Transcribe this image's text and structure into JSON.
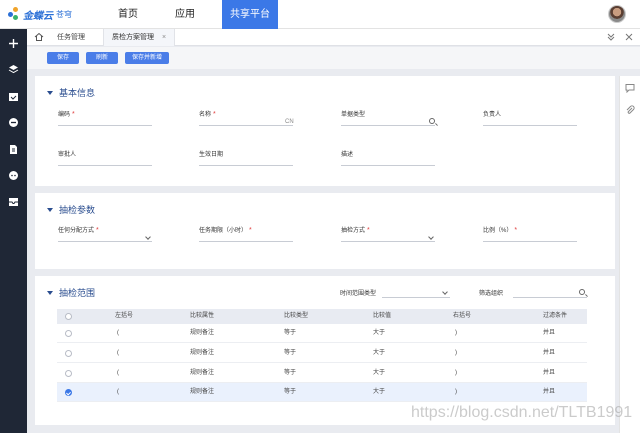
{
  "brand": {
    "name": "金蝶云",
    "sub": "苍穹",
    "colors": [
      "#2a6fd6",
      "#f0a42a",
      "#38b36b"
    ]
  },
  "top_nav": [
    {
      "label": "首页",
      "active": false
    },
    {
      "label": "应用",
      "active": false
    },
    {
      "label": "共享平台",
      "active": true
    }
  ],
  "sidebar_icons": [
    "plus-icon",
    "layers-icon",
    "calendar-check-icon",
    "minus-circle-icon",
    "document-icon",
    "chat-icon",
    "inbox-icon"
  ],
  "tabs": [
    {
      "label": "任务管理",
      "active": false,
      "closable": false
    },
    {
      "label": "质检方案管理",
      "active": true,
      "closable": true,
      "close_glyph": "×"
    }
  ],
  "toolbar": {
    "save": "保存",
    "refresh": "刷新",
    "save_new": "保存并新增"
  },
  "basic_info": {
    "title": "基本信息",
    "fields": {
      "code": {
        "label": "编码",
        "required": true
      },
      "name": {
        "label": "名称",
        "required": true,
        "suffix": "CN"
      },
      "bill_type": {
        "label": "单据类型",
        "required": false
      },
      "owner": {
        "label": "负责人",
        "required": false
      },
      "approver": {
        "label": "审批人",
        "required": false
      },
      "effective_date": {
        "label": "生效日期",
        "required": false
      },
      "description": {
        "label": "描述",
        "required": false
      }
    }
  },
  "sampling_params": {
    "title": "抽检参数",
    "fields": {
      "assign_method": {
        "label": "任何分配方式",
        "required": true
      },
      "task_deadline": {
        "label": "任务期限（小时）",
        "required": true
      },
      "sampling_method": {
        "label": "抽检方式",
        "required": true
      },
      "ratio": {
        "label": "比例（%）",
        "required": true
      }
    }
  },
  "sampling_scope": {
    "title": "抽检范围",
    "time_range_label": "时间范围类型",
    "filter_org_label": "筛选组织",
    "columns": [
      "左括号",
      "比较属性",
      "比较类型",
      "比较值",
      "右括号",
      "过滤条件"
    ],
    "rows": [
      {
        "selected": false,
        "cells": [
          "(",
          "规则备注",
          "等于",
          "大于",
          ")",
          "并且"
        ]
      },
      {
        "selected": false,
        "cells": [
          "(",
          "规则备注",
          "等于",
          "大于",
          ")",
          "并且"
        ]
      },
      {
        "selected": false,
        "cells": [
          "(",
          "规则备注",
          "等于",
          "大于",
          ")",
          "并且"
        ]
      },
      {
        "selected": true,
        "cells": [
          "(",
          "规则备注",
          "等于",
          "大于",
          ")",
          "并且"
        ]
      }
    ]
  },
  "watermark": "https://blog.csdn.net/TLTB1991",
  "accent_color": "#3b78e7"
}
